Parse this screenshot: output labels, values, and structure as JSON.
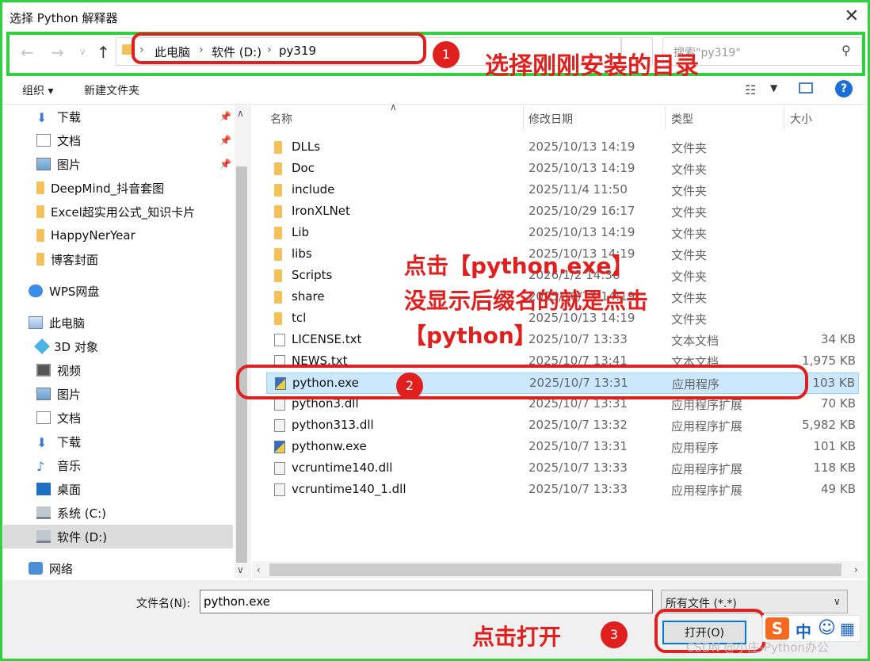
{
  "window": {
    "title": "选择 Python 解释器",
    "close_icon": "close-icon"
  },
  "address": {
    "crumbs": [
      "此电脑",
      "软件 (D:)",
      "py319"
    ],
    "search_placeholder": "搜索\"py319\""
  },
  "toolbar": {
    "organize": "组织 ▾",
    "new_folder": "新建文件夹"
  },
  "nav": {
    "items": [
      {
        "label": "下载",
        "icon": "download-icon",
        "pinned": true
      },
      {
        "label": "文档",
        "icon": "document-icon",
        "pinned": true
      },
      {
        "label": "图片",
        "icon": "picture-icon",
        "pinned": true
      },
      {
        "label": "DeepMind_抖音套图",
        "icon": "folder-icon"
      },
      {
        "label": "Excel超实用公式_知识卡片",
        "icon": "folder-icon"
      },
      {
        "label": "HappyNerYear",
        "icon": "folder-icon"
      },
      {
        "label": "博客封面",
        "icon": "folder-icon"
      },
      {
        "label": "WPS网盘",
        "icon": "cloud-icon"
      },
      {
        "label": "此电脑",
        "icon": "computer-icon"
      },
      {
        "label": "3D 对象",
        "icon": "3d-objects-icon"
      },
      {
        "label": "视频",
        "icon": "video-icon"
      },
      {
        "label": "图片",
        "icon": "picture-icon"
      },
      {
        "label": "文档",
        "icon": "document-icon"
      },
      {
        "label": "下载",
        "icon": "download-icon"
      },
      {
        "label": "音乐",
        "icon": "music-icon"
      },
      {
        "label": "桌面",
        "icon": "desktop-icon"
      },
      {
        "label": "系统 (C:)",
        "icon": "drive-icon"
      },
      {
        "label": "软件 (D:)",
        "icon": "drive-icon"
      },
      {
        "label": "网络",
        "icon": "network-icon"
      }
    ]
  },
  "columns": {
    "name": "名称",
    "date": "修改日期",
    "type": "类型",
    "size": "大小"
  },
  "files": [
    {
      "name": "DLLs",
      "date": "2025/10/13 14:19",
      "type": "文件夹",
      "size": "",
      "kind": "folder"
    },
    {
      "name": "Doc",
      "date": "2025/10/13 14:19",
      "type": "文件夹",
      "size": "",
      "kind": "folder"
    },
    {
      "name": "include",
      "date": "2025/11/4 11:50",
      "type": "文件夹",
      "size": "",
      "kind": "folder"
    },
    {
      "name": "IronXLNet",
      "date": "2025/10/29 16:17",
      "type": "文件夹",
      "size": "",
      "kind": "folder"
    },
    {
      "name": "Lib",
      "date": "2025/10/13 14:19",
      "type": "文件夹",
      "size": "",
      "kind": "folder"
    },
    {
      "name": "libs",
      "date": "2025/10/13 14:19",
      "type": "文件夹",
      "size": "",
      "kind": "folder"
    },
    {
      "name": "Scripts",
      "date": "2026/1/2 14:36",
      "type": "文件夹",
      "size": "",
      "kind": "folder"
    },
    {
      "name": "share",
      "date": "2025/10/13 14:19",
      "type": "文件夹",
      "size": "",
      "kind": "folder"
    },
    {
      "name": "tcl",
      "date": "2025/10/13 14:19",
      "type": "文件夹",
      "size": "",
      "kind": "folder"
    },
    {
      "name": "LICENSE.txt",
      "date": "2025/10/7 13:33",
      "type": "文本文档",
      "size": "34 KB",
      "kind": "txt"
    },
    {
      "name": "NEWS.txt",
      "date": "2025/10/7 13:41",
      "type": "文本文档",
      "size": "1,975 KB",
      "kind": "txt"
    },
    {
      "name": "python.exe",
      "date": "2025/10/7 13:31",
      "type": "应用程序",
      "size": "103 KB",
      "kind": "exe",
      "selected": true
    },
    {
      "name": "python3.dll",
      "date": "2025/10/7 13:31",
      "type": "应用程序扩展",
      "size": "70 KB",
      "kind": "dll"
    },
    {
      "name": "python313.dll",
      "date": "2025/10/7 13:32",
      "type": "应用程序扩展",
      "size": "5,982 KB",
      "kind": "dll"
    },
    {
      "name": "pythonw.exe",
      "date": "2025/10/7 13:31",
      "type": "应用程序",
      "size": "101 KB",
      "kind": "exe"
    },
    {
      "name": "vcruntime140.dll",
      "date": "2025/10/7 13:33",
      "type": "应用程序扩展",
      "size": "118 KB",
      "kind": "dll"
    },
    {
      "name": "vcruntime140_1.dll",
      "date": "2025/10/7 13:33",
      "type": "应用程序扩展",
      "size": "49 KB",
      "kind": "dll"
    }
  ],
  "bottom": {
    "filename_label": "文件名(N):",
    "filename_value": "python.exe",
    "filetype_value": "所有文件 (*.*)",
    "open_label": "打开(O)"
  },
  "annotations": {
    "step1_number": "1",
    "step1_text": "选择刚刚安装的目录",
    "step2_number": "2",
    "step2_text_line1": "点击【python.exe】",
    "step2_text_line2": "没显示后缀名的就是点击",
    "step2_text_line3": "【python】",
    "step3_number": "3",
    "step3_text": "点击打开",
    "highlight_green": "#2fd23d",
    "annotation_red": "#e0201e"
  },
  "ime": {
    "s": "S",
    "zh": "中"
  },
  "watermark": "CSDN @小庄-Python办公"
}
